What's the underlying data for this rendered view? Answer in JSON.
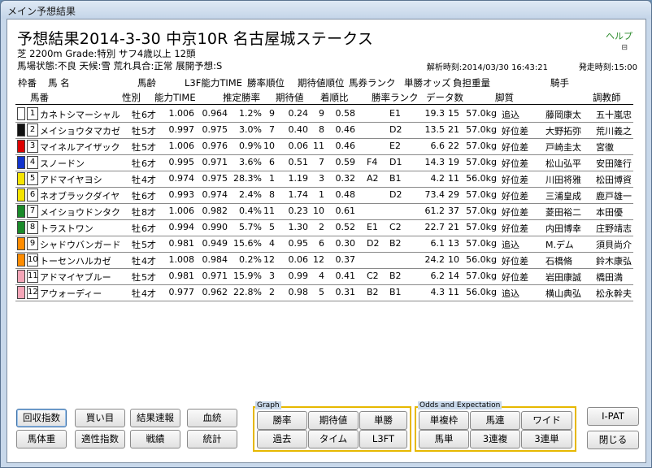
{
  "window": {
    "title": "メイン予想結果"
  },
  "header": {
    "race_title": "予想結果2014-3-30 中京10R 名古屋城ステークス",
    "help": "ヘルプ",
    "info_line1": "芝 2200m  Grade:特別 サフ4歳以上  12頭",
    "info_line2": "馬場状態:不良   天候:雪   荒れ具合:正常   展開予想:S",
    "analysis_time": "解析時刻:2014/03/30 16:43:21",
    "start_time": "発走時刻:15:00"
  },
  "columns": {
    "row1": [
      "枠番",
      "馬 名",
      "馬齢",
      "L3F能力TIME",
      "勝率順位",
      "期待値順位",
      "馬券ランク",
      "単勝オッズ",
      "負担重量",
      "騎手"
    ],
    "row2": [
      "馬番",
      "性別",
      "能力TIME",
      "推定勝率",
      "期待値",
      "着順比",
      "勝率ランク",
      "データ数",
      "脚質",
      "調教師"
    ]
  },
  "horses": [
    {
      "waku": "1",
      "waku_color": "#ffffff",
      "ban": "1",
      "name": "カネトシマーシャル",
      "sex": "牡",
      "age": "6才",
      "time": "1.006",
      "l3f": "0.964",
      "rate": "1.2%",
      "rate_rank": "9",
      "exp": "0.24",
      "exp_rank": "9",
      "ratio": "0.58",
      "ticket": "",
      "win_rank": "E1",
      "odds": "19.3",
      "data": "15",
      "weight": "57.0kg",
      "style": "追込",
      "jockey": "藤岡康太",
      "trainer": "五十嵐忠"
    },
    {
      "waku": "2",
      "waku_color": "#111111",
      "ban": "2",
      "name": "メイショウタマカゼ",
      "sex": "牡",
      "age": "5才",
      "time": "0.997",
      "l3f": "0.975",
      "rate": "3.0%",
      "rate_rank": "7",
      "exp": "0.40",
      "exp_rank": "8",
      "ratio": "0.46",
      "ticket": "",
      "win_rank": "D2",
      "odds": "13.5",
      "data": "21",
      "weight": "57.0kg",
      "style": "好位差",
      "jockey": "大野拓弥",
      "trainer": "荒川義之"
    },
    {
      "waku": "3",
      "waku_color": "#dd0000",
      "ban": "3",
      "name": "マイネルアイザック",
      "sex": "牡",
      "age": "5才",
      "time": "1.006",
      "l3f": "0.976",
      "rate": "0.9%",
      "rate_rank": "10",
      "exp": "0.06",
      "exp_rank": "11",
      "ratio": "0.46",
      "ticket": "",
      "win_rank": "E2",
      "odds": "6.6",
      "data": "22",
      "weight": "57.0kg",
      "style": "好位差",
      "jockey": "戸崎圭太",
      "trainer": "宮徹"
    },
    {
      "waku": "4",
      "waku_color": "#1133cc",
      "ban": "4",
      "name": "スノードン",
      "sex": "牡",
      "age": "6才",
      "time": "0.995",
      "l3f": "0.971",
      "rate": "3.6%",
      "rate_rank": "6",
      "exp": "0.51",
      "exp_rank": "7",
      "ratio": "0.59",
      "ticket": "F4",
      "win_rank": "D1",
      "odds": "14.3",
      "data": "19",
      "weight": "57.0kg",
      "style": "好位差",
      "jockey": "松山弘平",
      "trainer": "安田隆行"
    },
    {
      "waku": "5",
      "waku_color": "#f5e400",
      "ban": "5",
      "name": "アドマイヤヨシ",
      "sex": "牡",
      "age": "4才",
      "time": "0.974",
      "l3f": "0.975",
      "rate": "28.3%",
      "rate_rank": "1",
      "exp": "1.19",
      "exp_rank": "3",
      "ratio": "0.32",
      "ticket": "A2",
      "win_rank": "B1",
      "odds": "4.2",
      "data": "11",
      "weight": "56.0kg",
      "style": "好位差",
      "jockey": "川田将雅",
      "trainer": "松田博資"
    },
    {
      "waku": "5",
      "waku_color": "#f5e400",
      "ban": "6",
      "name": "ネオブラックダイヤ",
      "sex": "牡",
      "age": "6才",
      "time": "0.993",
      "l3f": "0.974",
      "rate": "2.4%",
      "rate_rank": "8",
      "exp": "1.74",
      "exp_rank": "1",
      "ratio": "0.48",
      "ticket": "",
      "win_rank": "D2",
      "odds": "73.4",
      "data": "29",
      "weight": "57.0kg",
      "style": "好位差",
      "jockey": "三浦皇成",
      "trainer": "鹿戸雄一"
    },
    {
      "waku": "6",
      "waku_color": "#1a8a2a",
      "ban": "7",
      "name": "メイショウドンタク",
      "sex": "牡",
      "age": "8才",
      "time": "1.006",
      "l3f": "0.982",
      "rate": "0.4%",
      "rate_rank": "11",
      "exp": "0.23",
      "exp_rank": "10",
      "ratio": "0.61",
      "ticket": "",
      "win_rank": "",
      "odds": "61.2",
      "data": "37",
      "weight": "57.0kg",
      "style": "好位差",
      "jockey": "菱田裕二",
      "trainer": "本田優"
    },
    {
      "waku": "6",
      "waku_color": "#1a8a2a",
      "ban": "8",
      "name": "トラストワン",
      "sex": "牡",
      "age": "6才",
      "time": "0.994",
      "l3f": "0.990",
      "rate": "5.7%",
      "rate_rank": "5",
      "exp": "1.30",
      "exp_rank": "2",
      "ratio": "0.52",
      "ticket": "E1",
      "win_rank": "C2",
      "odds": "22.7",
      "data": "21",
      "weight": "57.0kg",
      "style": "好位差",
      "jockey": "内田博幸",
      "trainer": "庄野靖志"
    },
    {
      "waku": "7",
      "waku_color": "#ff8c00",
      "ban": "9",
      "name": "シャドウバンガード",
      "sex": "牡",
      "age": "5才",
      "time": "0.981",
      "l3f": "0.949",
      "rate": "15.6%",
      "rate_rank": "4",
      "exp": "0.95",
      "exp_rank": "6",
      "ratio": "0.30",
      "ticket": "D2",
      "win_rank": "B2",
      "odds": "6.1",
      "data": "13",
      "weight": "57.0kg",
      "style": "追込",
      "jockey": "M.デム",
      "trainer": "須貝尚介"
    },
    {
      "waku": "7",
      "waku_color": "#ff8c00",
      "ban": "10",
      "name": "トーセンハルカゼ",
      "sex": "牡",
      "age": "4才",
      "time": "1.008",
      "l3f": "0.984",
      "rate": "0.2%",
      "rate_rank": "12",
      "exp": "0.06",
      "exp_rank": "12",
      "ratio": "0.37",
      "ticket": "",
      "win_rank": "",
      "odds": "24.2",
      "data": "10",
      "weight": "56.0kg",
      "style": "好位差",
      "jockey": "石橋脩",
      "trainer": "鈴木康弘"
    },
    {
      "waku": "8",
      "waku_color": "#f4a6b8",
      "ban": "11",
      "name": "アドマイヤブルー",
      "sex": "牡",
      "age": "5才",
      "time": "0.981",
      "l3f": "0.971",
      "rate": "15.9%",
      "rate_rank": "3",
      "exp": "0.99",
      "exp_rank": "4",
      "ratio": "0.41",
      "ticket": "C2",
      "win_rank": "B2",
      "odds": "6.2",
      "data": "14",
      "weight": "57.0kg",
      "style": "好位差",
      "jockey": "岩田康誠",
      "trainer": "橋田満"
    },
    {
      "waku": "8",
      "waku_color": "#f4a6b8",
      "ban": "12",
      "name": "アウォーディー",
      "sex": "牡",
      "age": "4才",
      "time": "0.977",
      "l3f": "0.962",
      "rate": "22.8%",
      "rate_rank": "2",
      "exp": "0.98",
      "exp_rank": "5",
      "ratio": "0.31",
      "ticket": "B2",
      "win_rank": "B1",
      "odds": "4.3",
      "data": "11",
      "weight": "56.0kg",
      "style": "追込",
      "jockey": "横山典弘",
      "trainer": "松永幹夫"
    }
  ],
  "buttons": {
    "kaishu": "回収指数",
    "kaime": "買い目",
    "kekka": "結果速報",
    "ketto": "血統",
    "bataiju": "馬体重",
    "tekisei": "適性指数",
    "senseki": "戦績",
    "tokei": "統計",
    "graph_label": "Graph",
    "shoritsu": "勝率",
    "kitaichi": "期待値",
    "tansho": "単勝",
    "kako": "過去",
    "time": "タイム",
    "l3ft": "L3FT",
    "odds_label": "Odds and Expectation",
    "tanfuku": "単複枠",
    "umaren": "馬連",
    "wide": "ワイド",
    "umatan": "馬単",
    "sanrenpuku": "3連複",
    "sanrentan": "3連単",
    "ipat": "I-PAT",
    "close": "閉じる"
  }
}
